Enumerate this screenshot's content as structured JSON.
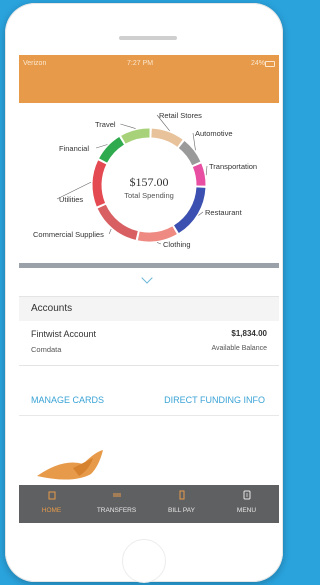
{
  "status_bar": {
    "carrier": "Verizon",
    "time": "7:27 PM",
    "battery": "24%"
  },
  "colors": {
    "header": "#e79a49",
    "link": "#3aa3d6",
    "tabbar": "#5f6062",
    "page_bg": "#2aa3dd"
  },
  "chart_data": {
    "type": "pie",
    "center_value": "$157.00",
    "center_label": "Total Spending",
    "categories": [
      "Retail Stores",
      "Automotive",
      "Transportation",
      "Restaurant",
      "Clothing",
      "Commercial Supplies",
      "Utilities",
      "Financial",
      "Travel"
    ],
    "values": [
      10,
      8,
      7,
      16,
      12,
      15,
      14,
      9,
      9
    ],
    "colors": [
      "#e8c29a",
      "#9a9a9a",
      "#e84fa2",
      "#3b50b0",
      "#ee8a82",
      "#d85f62",
      "#e44a52",
      "#2faa4e",
      "#a8d27a"
    ]
  },
  "accounts": {
    "title": "Accounts",
    "items": [
      {
        "name": "Fintwist Account",
        "provider": "Comdata",
        "amount": "$1,834.00",
        "amount_label": "Available Balance"
      }
    ]
  },
  "links": {
    "manage_cards": "MANAGE CARDS",
    "direct_funding": "DIRECT FUNDING INFO"
  },
  "tabs": [
    {
      "label": "HOME",
      "icon": "home-icon"
    },
    {
      "label": "TRANSFERS",
      "icon": "transfer-icon"
    },
    {
      "label": "BILL PAY",
      "icon": "bill-icon"
    },
    {
      "label": "MENU",
      "icon": "menu-icon"
    }
  ]
}
